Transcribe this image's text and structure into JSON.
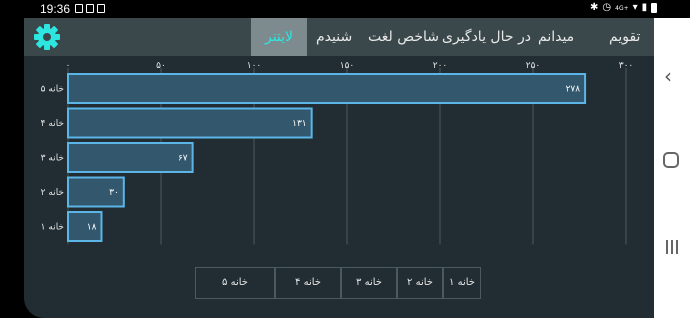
{
  "status_bar": {
    "time": "19:36",
    "network": "4G+",
    "icons": [
      "image-icon",
      "alert-icon",
      "square-icon",
      "bluetooth-icon",
      "alarm-icon",
      "network-icon",
      "wifi-icon",
      "signal-icon",
      "battery-icon"
    ]
  },
  "header": {
    "settings_icon": "gear-icon",
    "tabs": [
      {
        "label": "تقویم"
      },
      {
        "label": "میدانم"
      },
      {
        "label": "در حال یادگیری"
      },
      {
        "label": "شاخص لغت"
      },
      {
        "label": "شنیدم"
      },
      {
        "label": "لایتنر"
      }
    ],
    "active_tab": "لایتنر"
  },
  "colors": {
    "accent": "#2ee6e0",
    "bar_fill": "#33586e",
    "bar_border": "#5bb5e6",
    "background": "#212d33",
    "header": "#3a484b"
  },
  "chart_data": {
    "type": "bar",
    "orientation": "horizontal",
    "categories": [
      "خانه ۵",
      "خانه ۴",
      "خانه ۳",
      "خانه ۲",
      "خانه ۱"
    ],
    "values": [
      278,
      131,
      67,
      30,
      18
    ],
    "value_labels": [
      "۲۷۸",
      "۱۳۱",
      "۶۷",
      "۳۰",
      "۱۸"
    ],
    "xlim": [
      0,
      300
    ],
    "ticks": [
      0,
      50,
      100,
      150,
      200,
      250,
      300
    ],
    "tick_labels": [
      "۰",
      "۵۰",
      "۱۰۰",
      "۱۵۰",
      "۲۰۰",
      "۲۵۰",
      "۳۰۰"
    ],
    "grid": true
  },
  "legend": {
    "items": [
      "خانه ۵",
      "خانه ۴",
      "خانه ۳",
      "خانه ۲",
      "خانه ۱"
    ]
  },
  "nav_bar": {
    "icons": [
      "back-icon",
      "home-icon",
      "recent-apps-icon"
    ]
  }
}
